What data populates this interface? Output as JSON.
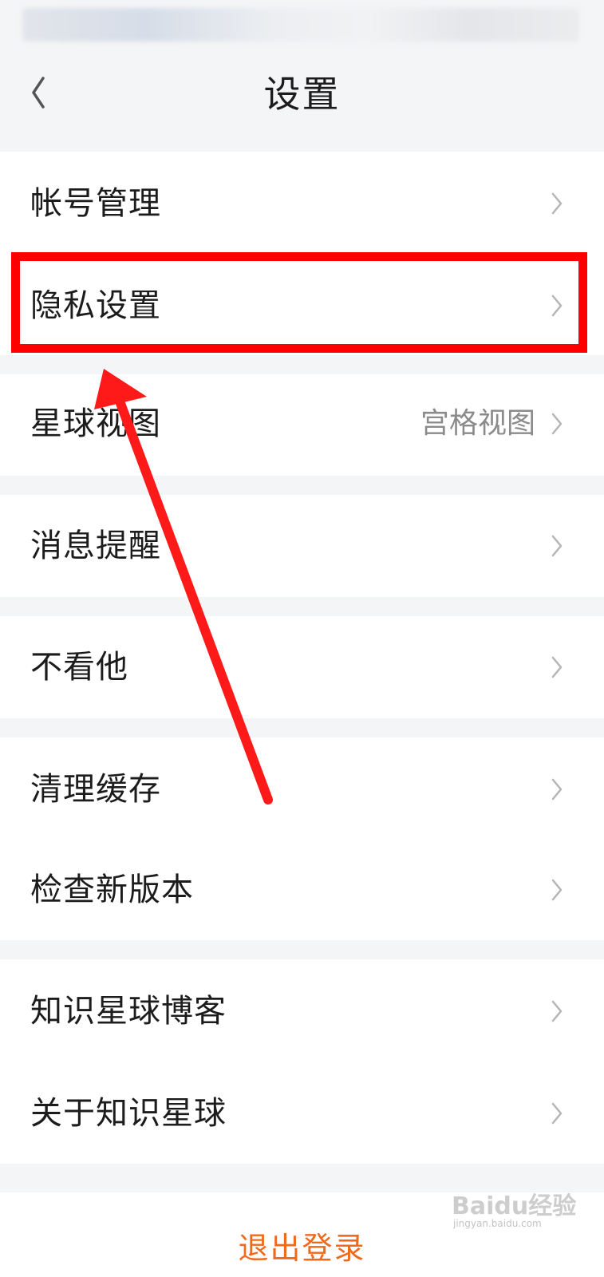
{
  "header": {
    "title": "设置"
  },
  "groups": [
    {
      "rows": [
        {
          "label": "帐号管理"
        },
        {
          "label": "隐私设置"
        },
        {
          "label": "星球视图",
          "value": "宫格视图"
        }
      ]
    },
    {
      "rows": [
        {
          "label": "消息提醒"
        }
      ]
    },
    {
      "rows": [
        {
          "label": "不看他"
        }
      ]
    },
    {
      "rows": [
        {
          "label": "清理缓存"
        },
        {
          "label": "检查新版本"
        }
      ]
    },
    {
      "rows": [
        {
          "label": "知识星球博客"
        },
        {
          "label": "关于知识星球"
        }
      ]
    }
  ],
  "logout": {
    "label": "退出登录"
  },
  "annotation": {
    "highlight_color": "#ff0000"
  },
  "watermark": {
    "brand": "Baidu经验",
    "url": "jingyan.baidu.com"
  }
}
